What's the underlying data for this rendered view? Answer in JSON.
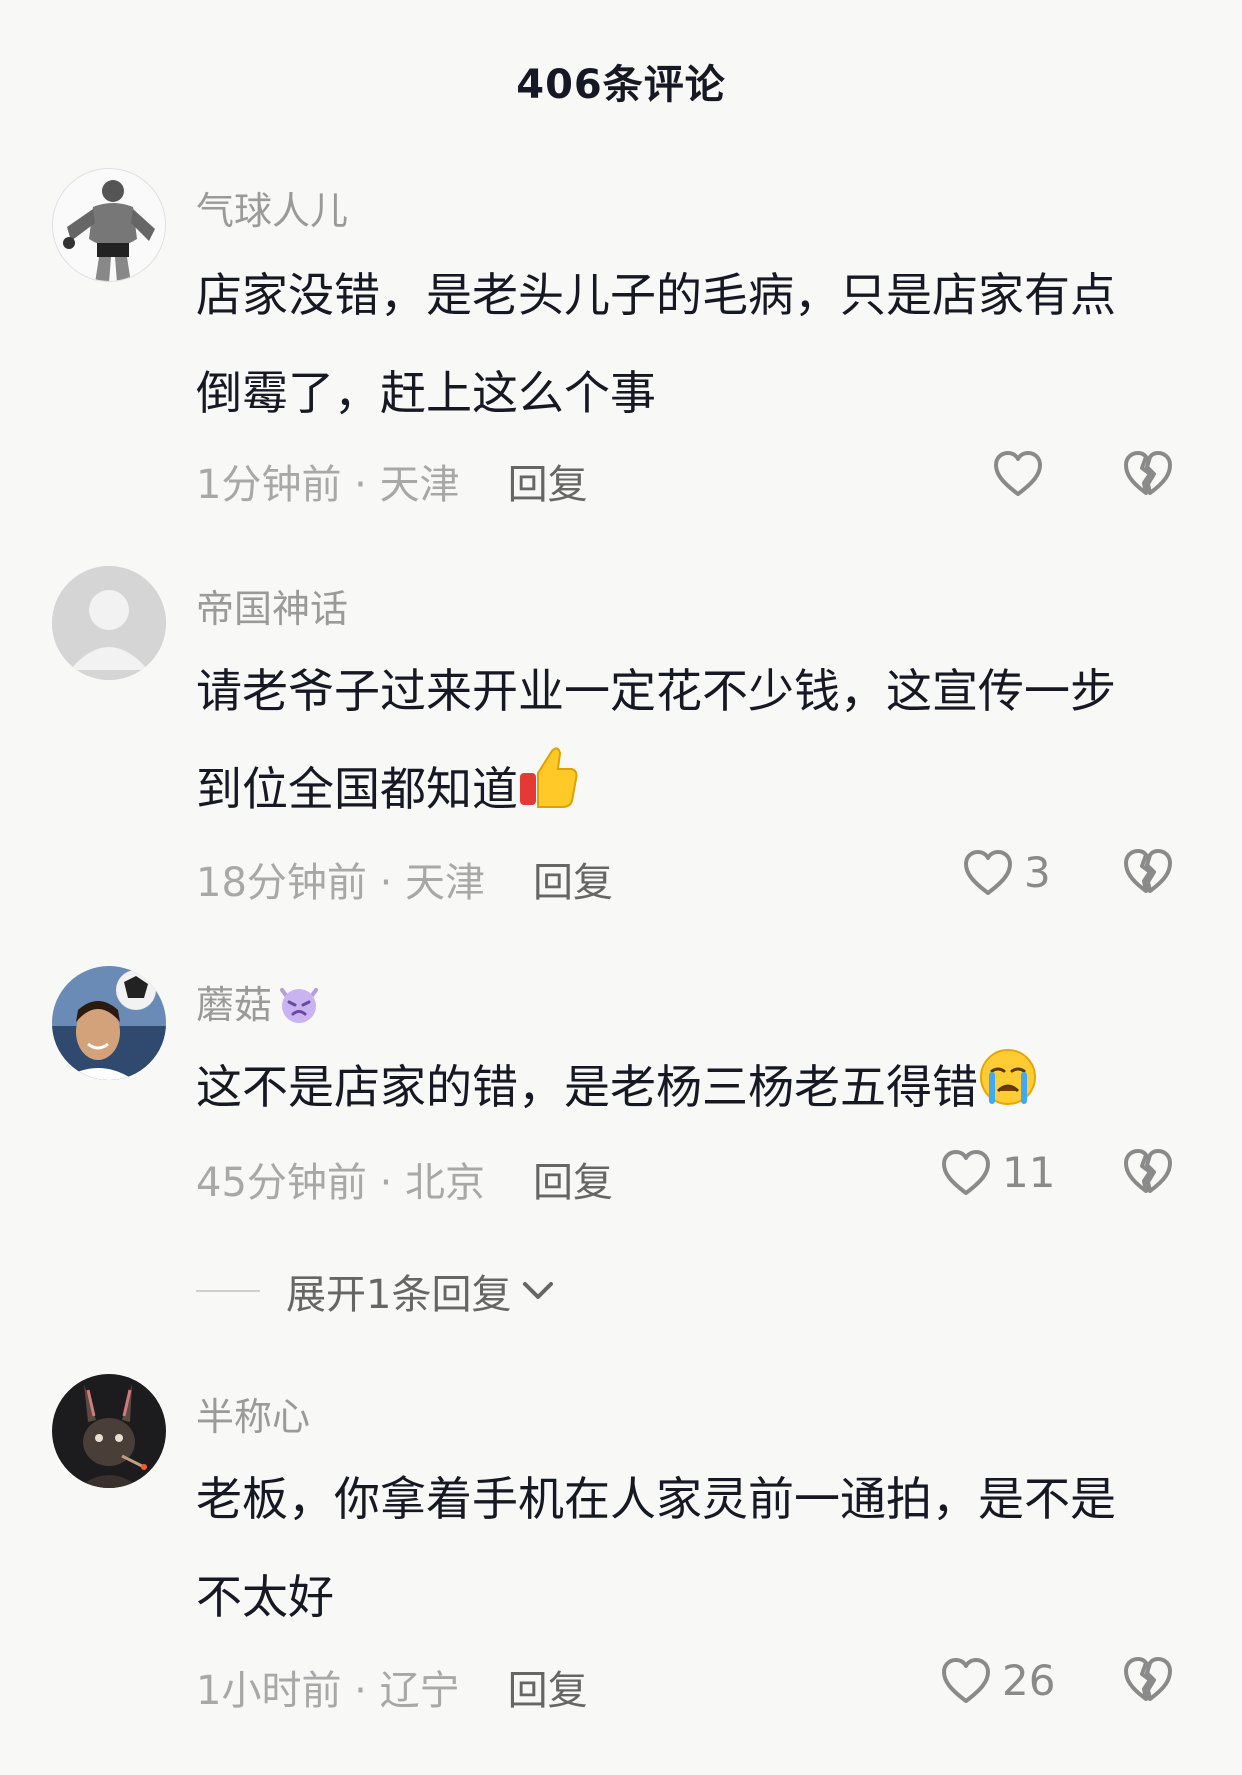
{
  "header": {
    "title": "406条评论"
  },
  "comments": [
    {
      "username": "气球人儿",
      "text": "店家没错，是老头儿子的毛病，只是店家有点倒霉了，赶上这么个事",
      "time_location": "1分钟前 · 天津",
      "reply_label": "回复",
      "likes": ""
    },
    {
      "username": "帝国神话",
      "text": "请老爷子过来开业一定花不少钱，这宣传一步到位全国都知道",
      "time_location": "18分钟前 · 天津",
      "reply_label": "回复",
      "likes": "3"
    },
    {
      "username": "蘑菇",
      "text": "这不是店家的错，是老杨三杨老五得错",
      "time_location": "45分钟前 · 北京",
      "reply_label": "回复",
      "likes": "11"
    },
    {
      "username": "半称心",
      "text": "老板，你拿着手机在人家灵前一通拍，是不是不太好",
      "time_location": "1小时前 · 辽宁",
      "reply_label": "回复",
      "likes": "26"
    }
  ],
  "expand_replies": {
    "label": "展开1条回复"
  },
  "icons": {
    "like": "heart-outline-icon",
    "dislike": "broken-heart-icon",
    "thumbs_up_emoji": "thumbs-up-emoji",
    "crying_emoji": "crying-face-emoji",
    "devil_emoji": "angry-devil-emoji",
    "expand": "chevron-down-icon"
  },
  "colors": {
    "background": "#f8f8f7",
    "text_primary": "#161823",
    "text_secondary": "#9a9a9a",
    "icon": "#8a8a8a"
  }
}
